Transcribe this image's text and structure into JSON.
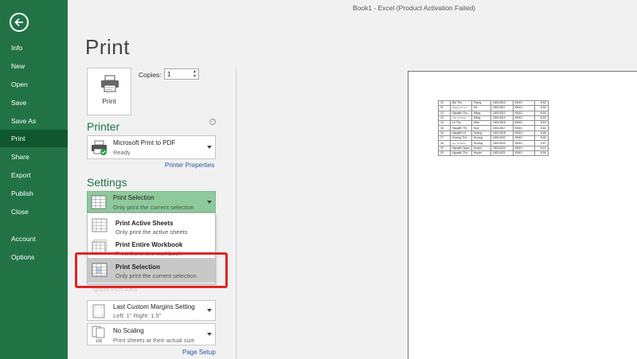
{
  "window": {
    "title": "Book1 - Excel (Product Activation Failed)"
  },
  "sidebar": {
    "items": [
      {
        "label": "Info"
      },
      {
        "label": "New"
      },
      {
        "label": "Open"
      },
      {
        "label": "Save"
      },
      {
        "label": "Save As"
      },
      {
        "label": "Print"
      },
      {
        "label": "Share"
      },
      {
        "label": "Export"
      },
      {
        "label": "Publish"
      },
      {
        "label": "Close"
      },
      {
        "label": "Account"
      },
      {
        "label": "Options"
      }
    ],
    "active": "Print"
  },
  "print": {
    "title": "Print",
    "button_label": "Print",
    "copies_label": "Copies:",
    "copies_value": "1"
  },
  "printer": {
    "heading": "Printer",
    "name": "Microsoft Print to PDF",
    "status": "Ready",
    "properties_link": "Printer Properties"
  },
  "settings": {
    "heading": "Settings",
    "selected": {
      "title": "Print Selection",
      "subtitle": "Only print the current selection"
    },
    "menu": [
      {
        "title": "Print Active Sheets",
        "subtitle": "Only print the active sheets"
      },
      {
        "title": "Print Entire Workbook",
        "subtitle": "Print the entire workbook"
      },
      {
        "title": "Print Selection",
        "subtitle": "Only print the current selection"
      }
    ],
    "ignore_print_area": "Ignore Print Area",
    "margins": {
      "title": "Last Custom Margins Setting",
      "subtitle": "Left: 1\"   Right: 1.5\""
    },
    "scaling": {
      "title": "No Scaling",
      "subtitle": "Print sheets at their actual size",
      "icon_text": "100"
    },
    "page_setup_link": "Page Setup"
  },
  "preview": {
    "rows": [
      [
        "10",
        "Bùi Thu",
        "Giang",
        "18014010",
        "K54I1",
        "8.62"
      ],
      [
        "11",
        "Hoàng Thị Thu",
        "Hà",
        "18014011",
        "K54I1",
        "8.50"
      ],
      [
        "12",
        "Nguyễn Thu",
        "Hằng",
        "18014012",
        "K54I1",
        "8.50"
      ],
      [
        "13",
        "Trần Thị Minh",
        "Hằng",
        "18014014",
        "K54I1",
        "8.53"
      ],
      [
        "14",
        "Lê Thu",
        "Hiền",
        "18014016",
        "K54I1",
        "8.64"
      ],
      [
        "15",
        "Nguyễn Thị",
        "Hoa",
        "18014017",
        "K54I1",
        "8.64"
      ],
      [
        "16",
        "Nguyễn Lê",
        "Hoàng",
        "18014018",
        "K54I1",
        "8.88"
      ],
      [
        "17",
        "Dương Thu",
        "Hương",
        "18014022",
        "K54I1",
        "8.60"
      ],
      [
        "18",
        "Lưu Thị Minh",
        "Hương",
        "18014023",
        "K54I1",
        "9.67"
      ],
      [
        "19",
        "Nguyễn Ngọc",
        "Huyền",
        "18014020",
        "K54I1",
        "8.15"
      ],
      [
        "20",
        "Nguyễn Thu",
        "Huyền",
        "18014021",
        "K54I1",
        "8.59"
      ]
    ]
  },
  "colors": {
    "brand": "#217346",
    "active_nav": "#10572f",
    "highlight": "#e02424",
    "accent_text": "#2b579a"
  }
}
